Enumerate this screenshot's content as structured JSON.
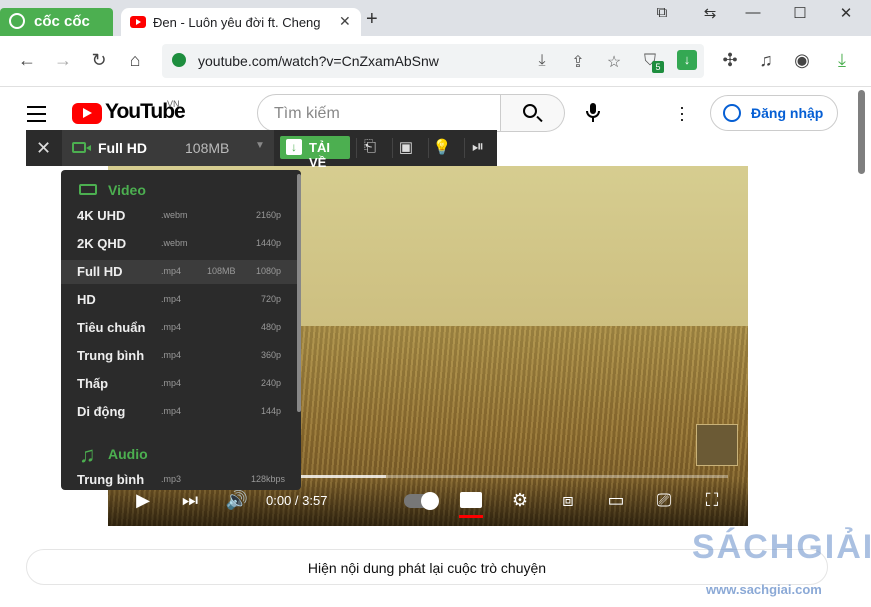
{
  "browser": {
    "brand": "cốc cốc",
    "tab_title": "Đen - Luôn yêu đời ft. Cheng",
    "tab_close": "✕",
    "new_tab": "+",
    "url": "youtube.com/watch?v=CnZxamAbSnw",
    "shield_badge": "5"
  },
  "youtube": {
    "logo_text": "YouTube",
    "region": "VN",
    "search_placeholder": "Tìm kiếm",
    "signin_label": "Đăng nhập"
  },
  "downloader": {
    "selected_label": "Full HD",
    "selected_size": "108MB",
    "download_label": "TẢI VỀ",
    "video_section": "Video",
    "audio_section": "Audio",
    "video_items": [
      {
        "label": "4K UHD",
        "ext": ".webm",
        "size": "",
        "res": "2160p"
      },
      {
        "label": "2K QHD",
        "ext": ".webm",
        "size": "",
        "res": "1440p"
      },
      {
        "label": "Full HD",
        "ext": ".mp4",
        "size": "108MB",
        "res": "1080p",
        "selected": true
      },
      {
        "label": "HD",
        "ext": ".mp4",
        "size": "",
        "res": "720p"
      },
      {
        "label": "Tiêu chuẩn",
        "ext": ".mp4",
        "size": "",
        "res": "480p"
      },
      {
        "label": "Trung bình",
        "ext": ".mp4",
        "size": "",
        "res": "360p"
      },
      {
        "label": "Thấp",
        "ext": ".mp4",
        "size": "",
        "res": "240p"
      },
      {
        "label": "Di động",
        "ext": ".mp4",
        "size": "",
        "res": "144p"
      }
    ],
    "audio_items": [
      {
        "label": "Trung bình",
        "ext": ".mp3",
        "size": "",
        "res": "128kbps"
      }
    ]
  },
  "player": {
    "time": "0:00 / 3:57",
    "progress": 0.43
  },
  "chat_replay": "Hiện nội dung phát lại cuộc trò chuyện",
  "watermark": {
    "brand": "SÁCHGIẢI",
    "url": "www.sachgiai.com"
  },
  "colors": {
    "accent_green": "#4caf50",
    "youtube_red": "#ff0000",
    "link_blue": "#065fd4"
  }
}
